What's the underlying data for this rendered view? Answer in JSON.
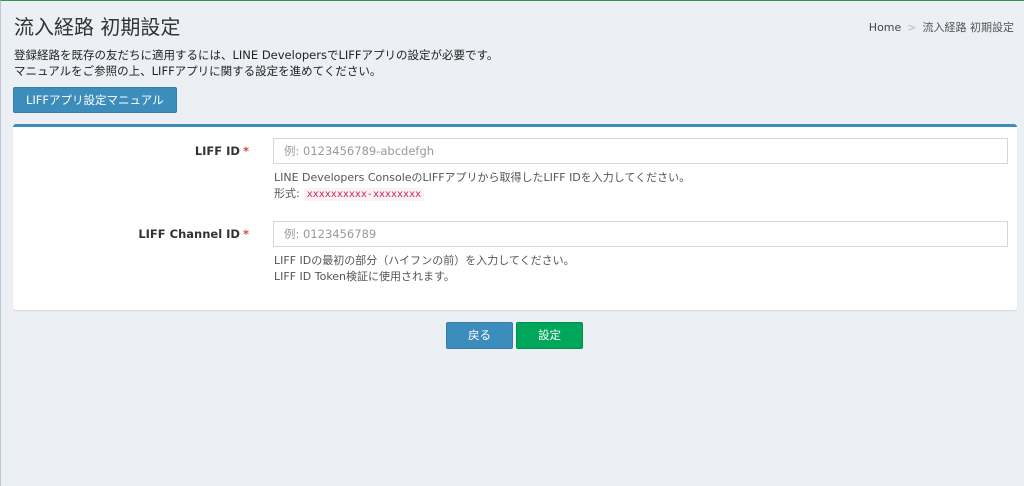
{
  "header": {
    "title": "流入経路 初期設定",
    "breadcrumb": {
      "home": "Home",
      "separator": ">",
      "current": "流入経路 初期設定"
    }
  },
  "intro": {
    "line1": "登録経路を既存の友だちに適用するには、LINE DevelopersでLIFFアプリの設定が必要です。",
    "line2": "マニュアルをご参照の上、LIFFアプリに関する設定を進めてください。"
  },
  "manual_button": "LIFFアプリ設定マニュアル",
  "form": {
    "liff_id": {
      "label": "LIFF ID",
      "required_mark": "*",
      "value": "",
      "placeholder": "例: 0123456789-abcdefgh",
      "help1": "LINE Developers ConsoleのLIFFアプリから取得したLIFF IDを入力してください。",
      "format_label": "形式:",
      "format_code": "xxxxxxxxxx-xxxxxxxx"
    },
    "liff_channel_id": {
      "label": "LIFF Channel ID",
      "required_mark": "*",
      "value": "",
      "placeholder": "例: 0123456789",
      "help1": "LIFF IDの最初の部分（ハイフンの前）を入力してください。",
      "help2": "LIFF ID Token検証に使用されます。"
    }
  },
  "actions": {
    "back": "戻る",
    "save": "設定"
  },
  "colors": {
    "primary": "#3c8dbc",
    "success": "#00a65a",
    "required": "#dd4b39",
    "code": "#c7254e"
  }
}
